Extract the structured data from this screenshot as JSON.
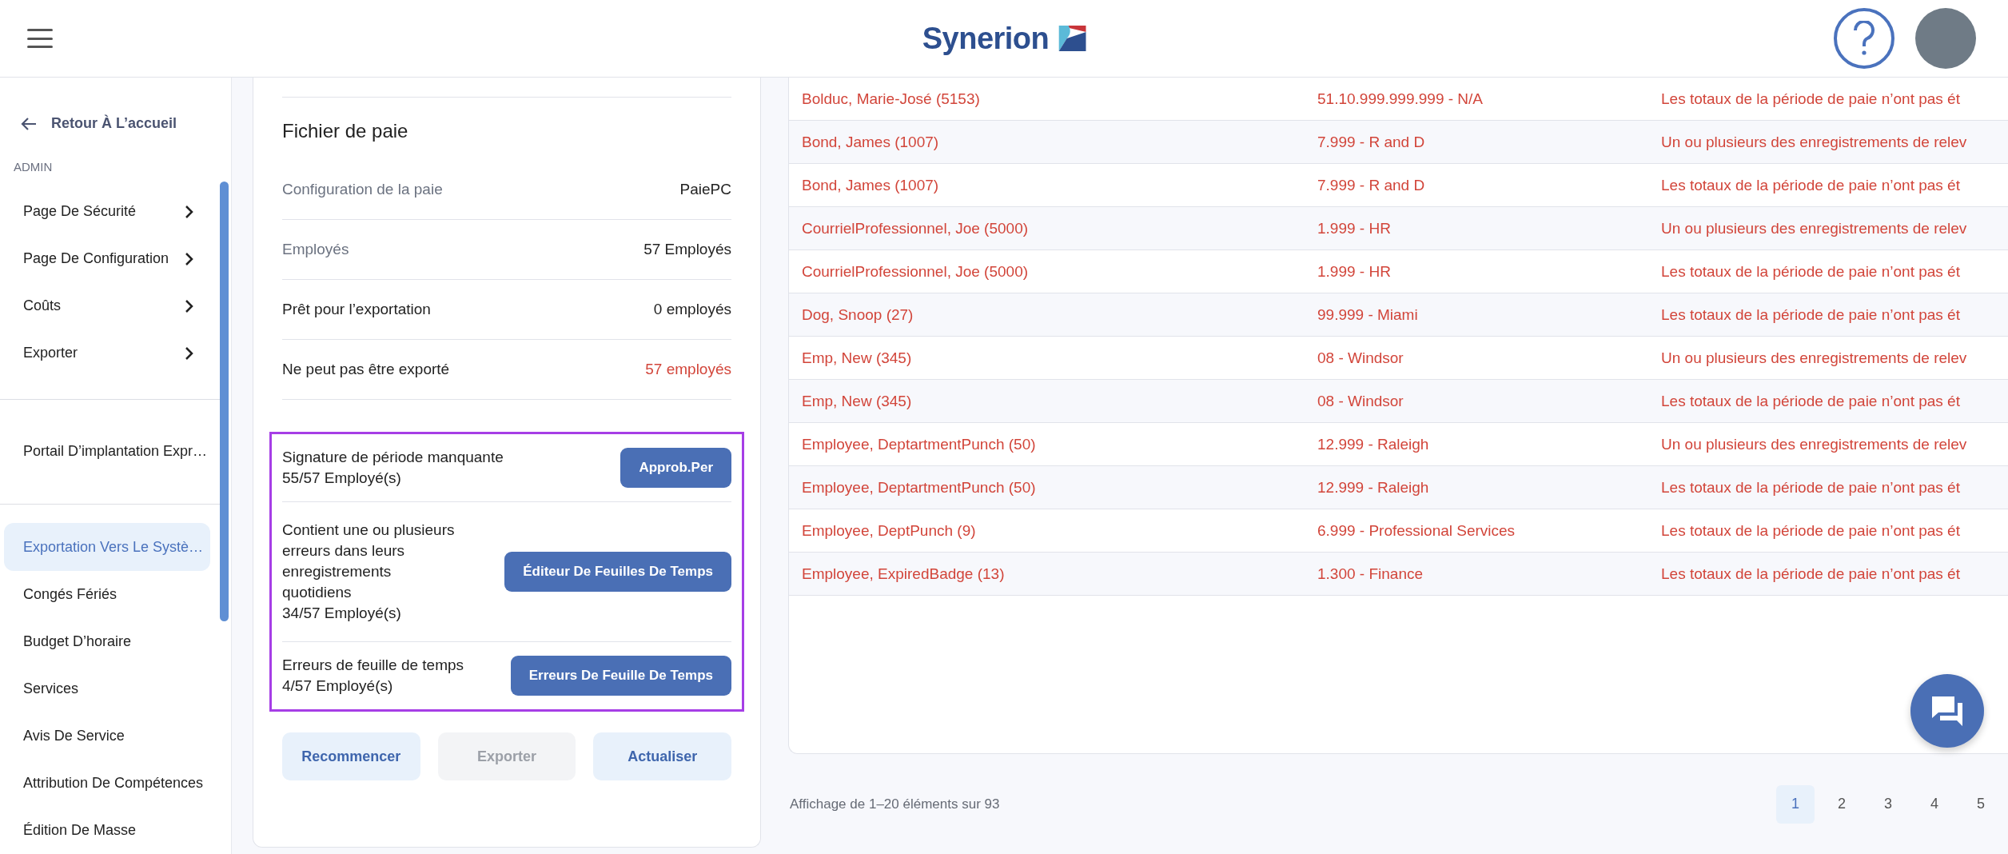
{
  "header": {
    "logo": "Synerion"
  },
  "sidebar": {
    "back": "Retour À L’accueil",
    "section": "ADMIN",
    "groups": [
      {
        "label": "Page De Sécurité",
        "expandable": true,
        "selected": false
      },
      {
        "label": "Page De Configuration",
        "expandable": true,
        "selected": false
      },
      {
        "label": "Coûts",
        "expandable": true,
        "selected": false
      },
      {
        "label": "Exporter",
        "expandable": true,
        "selected": false
      }
    ],
    "portal": {
      "label": "Portail D’implantation Expr…",
      "selected": false
    },
    "items": [
      {
        "label": "Exportation Vers Le Systè…",
        "selected": true
      },
      {
        "label": "Congés Fériés",
        "selected": false
      },
      {
        "label": "Budget D’horaire",
        "selected": false
      },
      {
        "label": "Services",
        "selected": false
      },
      {
        "label": "Avis De Service",
        "selected": false
      },
      {
        "label": "Attribution De Compétences",
        "selected": false
      },
      {
        "label": "Édition De Masse",
        "selected": false
      }
    ]
  },
  "summary": {
    "title": "Fichier de paie",
    "rows": [
      {
        "label": "Configuration de la paie",
        "value": "PaiePC",
        "muted": true,
        "alert": false
      },
      {
        "label": "Employés",
        "value": "57 Employés",
        "muted": true,
        "alert": false
      },
      {
        "label": "Prêt pour l’exportation",
        "value": "0 employés",
        "muted": false,
        "alert": false
      },
      {
        "label": "Ne peut pas être exporté",
        "value": "57 employés",
        "muted": false,
        "alert": true
      }
    ],
    "issues": [
      {
        "lines": [
          "Signature de période manquante",
          "55/57 Employé(s)"
        ],
        "button": "Approb.Per"
      },
      {
        "lines": [
          "Contient une ou plusieurs",
          "erreurs dans leurs",
          "enregistrements",
          "quotidiens",
          "34/57 Employé(s)"
        ],
        "button": "Éditeur De Feuilles De Temps"
      },
      {
        "lines": [
          "Erreurs de feuille de temps",
          "4/57 Employé(s)"
        ],
        "button": "Erreurs De Feuille De Temps"
      }
    ],
    "actions": [
      {
        "label": "Recommencer",
        "disabled": false
      },
      {
        "label": "Exporter",
        "disabled": true
      },
      {
        "label": "Actualiser",
        "disabled": false
      }
    ]
  },
  "table": {
    "rows": [
      [
        "Bolduc, Marie-José (5153)",
        "51.10.999.999.999 - N/A",
        "Les totaux de la période de paie n’ont pas ét"
      ],
      [
        "Bond, James (1007)",
        "7.999 - R and D",
        "Un ou plusieurs des enregistrements de relev"
      ],
      [
        "Bond, James (1007)",
        "7.999 - R and D",
        "Les totaux de la période de paie n’ont pas ét"
      ],
      [
        "CourrielProfessionnel, Joe (5000)",
        "1.999 - HR",
        "Un ou plusieurs des enregistrements de relev"
      ],
      [
        "CourrielProfessionnel, Joe (5000)",
        "1.999 - HR",
        "Les totaux de la période de paie n’ont pas ét"
      ],
      [
        "Dog, Snoop (27)",
        "99.999 - Miami",
        "Les totaux de la période de paie n’ont pas ét"
      ],
      [
        "Emp, New (345)",
        "08 - Windsor",
        "Un ou plusieurs des enregistrements de relev"
      ],
      [
        "Emp, New (345)",
        "08 - Windsor",
        "Les totaux de la période de paie n’ont pas ét"
      ],
      [
        "Employee, DeptartmentPunch (50)",
        "12.999 - Raleigh",
        "Un ou plusieurs des enregistrements de relev"
      ],
      [
        "Employee, DeptartmentPunch (50)",
        "12.999 - Raleigh",
        "Les totaux de la période de paie n’ont pas ét"
      ],
      [
        "Employee, DeptPunch (9)",
        "6.999 - Professional Services",
        "Les totaux de la période de paie n’ont pas ét"
      ],
      [
        "Employee, ExpiredBadge (13)",
        "1.300 - Finance",
        "Les totaux de la période de paie n’ont pas ét"
      ]
    ]
  },
  "pagination": {
    "summary": "Affichage de 1–20 éléments sur 93",
    "pages": [
      {
        "label": "1",
        "selected": true
      },
      {
        "label": "2",
        "selected": false
      },
      {
        "label": "3",
        "selected": false
      },
      {
        "label": "4",
        "selected": false
      },
      {
        "label": "5",
        "selected": false
      }
    ]
  }
}
